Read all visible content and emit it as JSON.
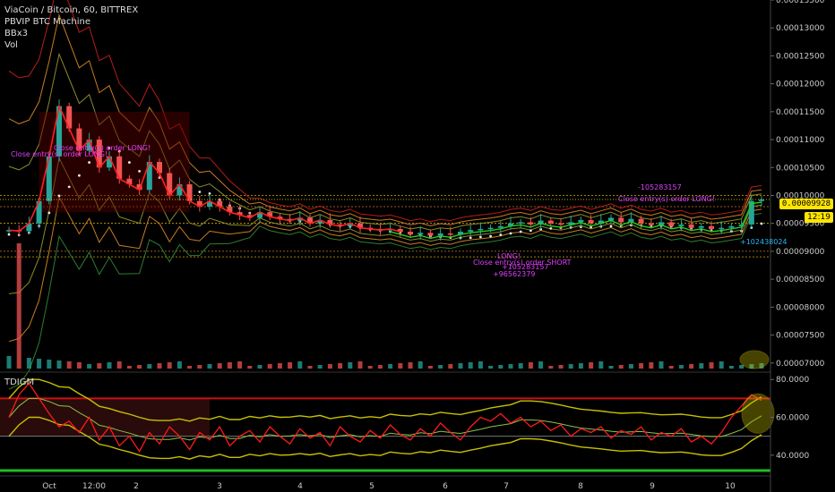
{
  "header": {
    "symbol": "ViaCoin  / Bitcoin, 60, BITTREX",
    "line2": "PBVIP BTC Machine",
    "line3": "BBx3",
    "line4": "Vol"
  },
  "indicator": {
    "name": "TDIGM"
  },
  "badges": {
    "price": "0.00009928",
    "time": "12:19"
  },
  "colors": {
    "bull": "#26a69a",
    "bear": "#ef5350",
    "band_red": "#b71c1c",
    "band_orange": "#c77c22",
    "band_olive": "#8a8a2a",
    "band_green": "#2e7d32",
    "tdi_line": "#ff1a1a",
    "tdi_band": "#c8c000",
    "green_line": "#1fbf1f",
    "pink": "#e040fb"
  },
  "chart_data": [
    {
      "type": "line",
      "subtype": "candlestick",
      "y_axis": {
        "range": [
          6.9e-06,
          1.35e-05
        ],
        "ticks": [
          "0.00013500",
          "0.00013000",
          "0.00012500",
          "0.00012000",
          "0.00011500",
          "0.00011000",
          "0.00010500",
          "0.00010000",
          "0.00009500",
          "0.00009000",
          "0.00008500",
          "0.00008000",
          "0.00007500",
          "0.00007000"
        ]
      },
      "x_axis": {
        "ticks": [
          "Oct",
          "12:00",
          "2",
          "3",
          "4",
          "5",
          "6",
          "7",
          "8",
          "9",
          "10"
        ]
      },
      "series": [
        {
          "values": [
            9380,
            9360,
            9500,
            9900,
            10700,
            11600,
            11200,
            10800,
            11000,
            10500,
            10700,
            10300,
            10200,
            10100,
            10600,
            10400,
            10000,
            10200,
            9900,
            9800,
            9900,
            9800,
            9700,
            9650,
            9600,
            9700,
            9620,
            9580,
            9550,
            9600,
            9500,
            9560,
            9480,
            9450,
            9500,
            9420,
            9400,
            9380,
            9400,
            9350,
            9300,
            9330,
            9280,
            9320,
            9300,
            9350,
            9380,
            9400,
            9420,
            9450,
            9500,
            9520,
            9480,
            9550,
            9500,
            9480,
            9520,
            9560,
            9500,
            9550,
            9600,
            9520,
            9580,
            9500,
            9470,
            9520,
            9450,
            9480,
            9420,
            9450,
            9400,
            9420,
            9450,
            9480,
            9900,
            9928
          ]
        }
      ],
      "annotations": [
        "Close entry(s) order LONG!",
        "Close entry(s) order LONG!",
        "-105283157",
        "Close entry(s) order SHORT",
        "+105283157",
        "+96562379",
        "LONG!",
        "+102438024"
      ]
    },
    {
      "type": "line",
      "y_axis": {
        "ticks": [
          "80.0000",
          "60.0000",
          "40.0000"
        ],
        "range": [
          30,
          82
        ]
      },
      "series": [
        {
          "values": [
            60,
            72,
            78,
            70,
            62,
            55,
            58,
            52,
            60,
            48,
            55,
            45,
            50,
            42,
            52,
            46,
            55,
            50,
            43,
            52,
            48,
            55,
            45,
            50,
            53,
            47,
            55,
            50,
            46,
            54,
            49,
            52,
            45,
            55,
            50,
            47,
            53,
            49,
            56,
            51,
            48,
            54,
            50,
            57,
            52,
            48,
            55,
            60,
            58,
            62,
            57,
            60,
            55,
            58,
            53,
            56,
            50,
            54,
            52,
            55,
            49,
            53,
            51,
            55,
            48,
            52,
            50,
            54,
            47,
            50,
            46,
            52,
            60,
            66,
            72,
            69
          ]
        }
      ]
    }
  ]
}
